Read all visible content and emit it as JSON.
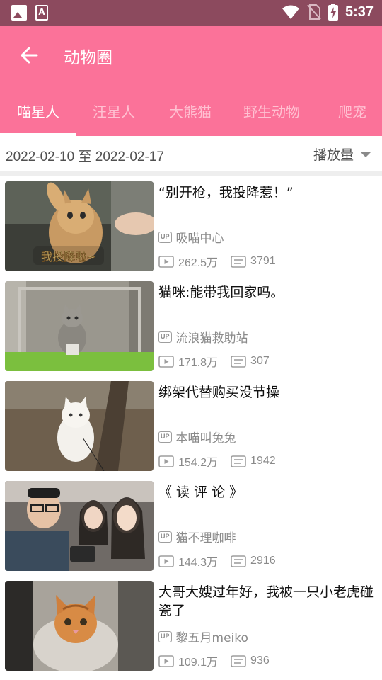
{
  "status_bar": {
    "time": "5:37",
    "icons": [
      "image-notification-icon",
      "a-notification-icon",
      "wifi-icon",
      "no-sim-icon",
      "battery-charging-icon"
    ]
  },
  "app_bar": {
    "title": "动物圈",
    "back_icon": "arrow-left-icon",
    "background": "#fb7299"
  },
  "tabs": [
    {
      "label": "喵星人",
      "active": true
    },
    {
      "label": "汪星人",
      "active": false
    },
    {
      "label": "大熊猫",
      "active": false
    },
    {
      "label": "野生动物",
      "active": false
    },
    {
      "label": "爬宠",
      "active": false
    }
  ],
  "filter": {
    "date_range": "2022-02-10 至 2022-02-17",
    "sort_label": "播放量"
  },
  "videos": [
    {
      "title": "“别开枪，我投降惹！”",
      "uploader": "吸喵中心",
      "views": "262.5万",
      "danmaku": "3791",
      "thumb_caption": "我投降啦~"
    },
    {
      "title": "猫咪:能带我回家吗。",
      "uploader": "流浪猫救助站",
      "views": "171.8万",
      "danmaku": "307"
    },
    {
      "title": "绑架代替购买没节操",
      "uploader": "本喵叫兔兔",
      "views": "154.2万",
      "danmaku": "1942"
    },
    {
      "title": "《 读 评 论 》",
      "uploader": "猫不理咖啡",
      "views": "144.3万",
      "danmaku": "2916"
    },
    {
      "title": "大哥大嫂过年好，我被一只小老虎碰瓷了",
      "uploader": "黎五月meiko",
      "views": "109.1万",
      "danmaku": "936"
    }
  ],
  "badges": {
    "up": "UP"
  }
}
